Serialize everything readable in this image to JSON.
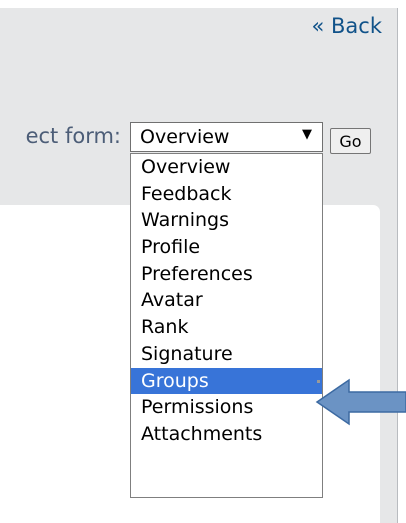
{
  "header": {
    "back_label": "« Back"
  },
  "form": {
    "select_label": "ect form:",
    "selected_value": "Overview",
    "arrow_glyph": "▼",
    "go_label": "Go"
  },
  "dropdown": {
    "options": [
      "Overview",
      "Feedback",
      "Warnings",
      "Profile",
      "Preferences",
      "Avatar",
      "Rank",
      "Signature",
      "Groups",
      "Permissions",
      "Attachments"
    ],
    "highlighted_option": "Groups"
  },
  "colors": {
    "background": "#e6e7e8",
    "link": "#105289",
    "label": "#4c5d77",
    "highlight": "#3874d8",
    "callout_arrow_fill": "#6b93c4",
    "callout_arrow_stroke": "#3c6aa2"
  },
  "annotation": {
    "arrow_icon": "left-arrow-callout"
  }
}
